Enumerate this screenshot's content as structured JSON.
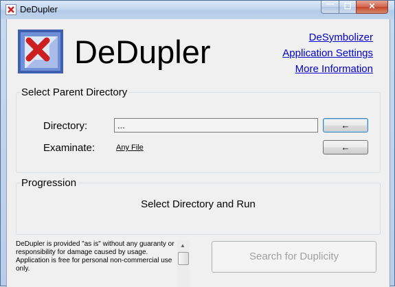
{
  "window": {
    "title": "DeDupler",
    "min_glyph": "—",
    "max_glyph": "☐",
    "close_glyph": "✕"
  },
  "header": {
    "app_title": "DeDupler",
    "logo_icon": "red-x-icon",
    "links": {
      "desymbolizer": "DeSymbolizer",
      "application_settings": "Application Settings",
      "more_information": "More Information"
    }
  },
  "parent_directory": {
    "group_label": "Select Parent Directory",
    "directory_label": "Directory:",
    "directory_value": "...",
    "directory_button_glyph": "←",
    "examinate_label": "Examinate:",
    "examinate_value": "Any File",
    "examinate_button_glyph": "←"
  },
  "progression": {
    "group_label": "Progression",
    "status_text": "Select Directory and Run"
  },
  "footer": {
    "disclaimer_lines": [
      "DeDupler is provided \"as is\" without any guaranty or responsibility for damage caused by usage.",
      "Application is free for personal non-commercial use only."
    ],
    "search_button": "Search for Duplicity"
  },
  "colors": {
    "link": "#0000cc",
    "logo_red": "#cc1f1f",
    "logo_blue": "#4a6fc2",
    "disabled_text": "#a0a0a0"
  }
}
